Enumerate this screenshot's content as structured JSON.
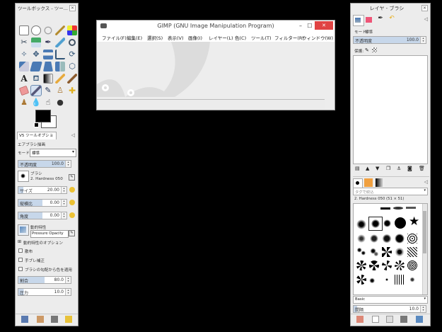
{
  "toolbox": {
    "title": "ツールボックス - ツー...",
    "tools": [
      "rect-select",
      "ellipse-select",
      "free-select",
      "fuzzy-select",
      "select-by-color",
      "scissors-select",
      "foreground-select",
      "paths",
      "color-picker",
      "zoom",
      "measure",
      "move",
      "align",
      "crop",
      "rotate",
      "scale",
      "shear",
      "perspective",
      "flip",
      "cage",
      "text",
      "bucket-fill",
      "blend",
      "pencil",
      "paintbrush",
      "eraser",
      "airbrush",
      "ink",
      "clone",
      "heal",
      "perspective-clone",
      "blur",
      "smudge",
      "dodge-burn"
    ],
    "options_tab": "ツールオプション",
    "options_tab_prefix": "V5",
    "mode_label": "モード:",
    "mode_value": "標準",
    "section_title": "エアブラシ描画",
    "opacity_label": "不透明度",
    "opacity_value": "100.0",
    "brush_label": "ブラシ",
    "brush_value": "2. Hardness 050",
    "size_label": "サイズ",
    "size_value": "20.00",
    "aspect_label": "縦横比",
    "aspect_value": "0.00",
    "angle_label": "角度",
    "angle_value": "0.00",
    "dynamics_label": "動的特性",
    "dynamics_value": "Pressure Opacity",
    "dynamics_opts_label": "動的特性のオプション",
    "jitter_label": "散布",
    "smooth_label": "手ブレ補正",
    "gradient_label": "ブラシの勾配から色を適用",
    "rate_label": "割合",
    "rate_value": "80.0",
    "pressure_label": "圧力",
    "pressure_value": "10.0"
  },
  "main": {
    "title": "GIMP (GNU Image Manipulation Program)",
    "menu": [
      "ファイル(F)",
      "編集(E)",
      "選択(S)",
      "表示(V)",
      "画像(I)",
      "レイヤー(L)",
      "色(C)",
      "ツール(T)",
      "フィルター(R)",
      "ウィンドウ(W)"
    ]
  },
  "layers": {
    "title": "レイヤ - ブラシ",
    "mode_label": "モード:",
    "mode_value": "標準",
    "opacity_label": "不透明度",
    "opacity_value": "100.0",
    "lock_label": "保護:",
    "brush_filter": "タグで絞込",
    "brush_current": "2. Hardness 050 (51 × 51)",
    "brush_set": "Basic",
    "spacing_label": "間隔",
    "spacing_value": "10.0"
  },
  "colors": {
    "fg": "#000000",
    "bg": "#ffffff",
    "accent": "#c7d7ea",
    "close": "#e04343"
  }
}
